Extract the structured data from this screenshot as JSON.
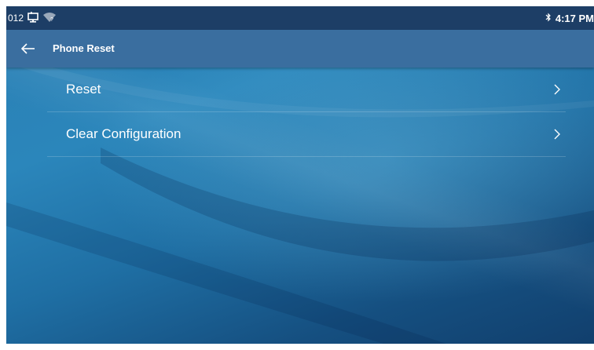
{
  "status_bar": {
    "extension": "012",
    "time": "4:17 PM",
    "bluetooth_icon": "bluetooth-icon",
    "network_icon": "monitor-network-icon",
    "wifi_icon": "wifi-unknown-icon"
  },
  "header": {
    "back_icon": "arrow-left-icon",
    "title": "Phone Reset"
  },
  "menu": {
    "items": [
      {
        "label": "Reset",
        "icon": "chevron-right-icon"
      },
      {
        "label": "Clear Configuration",
        "icon": "chevron-right-icon"
      }
    ]
  }
}
